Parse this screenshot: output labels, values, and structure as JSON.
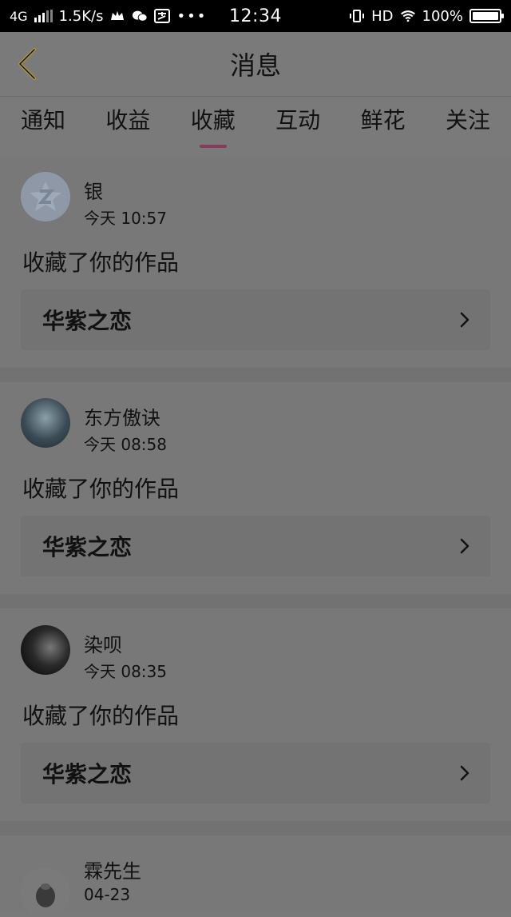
{
  "status_bar": {
    "network": "4G",
    "speed": "1.5K/s",
    "time": "12:34",
    "hd": "HD",
    "battery": "100%",
    "icons": [
      "signal-icon",
      "crown-icon",
      "wechat-icon",
      "alipay-icon",
      "more-icon",
      "vibrate-icon",
      "wifi-icon",
      "battery-icon"
    ]
  },
  "header": {
    "title": "消息",
    "back_icon": "chevron-left-icon"
  },
  "tabs": [
    {
      "label": "通知",
      "active": false
    },
    {
      "label": "收益",
      "active": false
    },
    {
      "label": "收藏",
      "active": true
    },
    {
      "label": "互动",
      "active": false
    },
    {
      "label": "鲜花",
      "active": false
    },
    {
      "label": "关注",
      "active": false
    }
  ],
  "colors": {
    "accent": "#8a3a5a"
  },
  "messages": [
    {
      "username": "银",
      "time": "今天 10:57",
      "action": "收藏了你的作品",
      "work": "华紫之恋"
    },
    {
      "username": "东方傲诀",
      "time": "今天 08:58",
      "action": "收藏了你的作品",
      "work": "华紫之恋"
    },
    {
      "username": "染呗",
      "time": "今天 08:35",
      "action": "收藏了你的作品",
      "work": "华紫之恋"
    },
    {
      "username": "霖先生",
      "time": "04-23"
    }
  ]
}
